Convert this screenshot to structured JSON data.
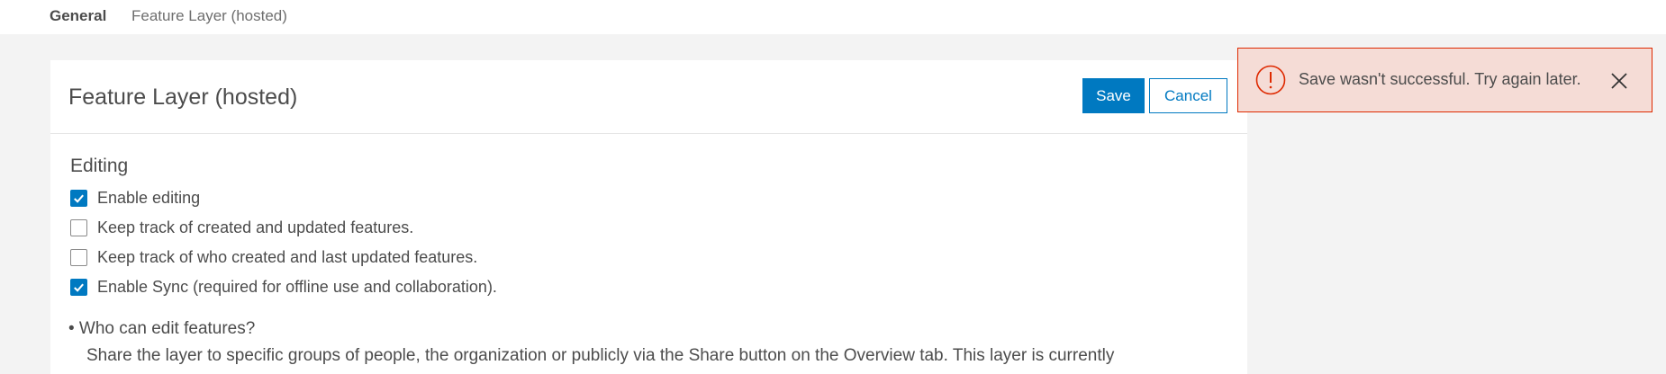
{
  "tabs": {
    "general": "General",
    "feature_layer": "Feature Layer (hosted)"
  },
  "card": {
    "title": "Feature Layer (hosted)",
    "save_label": "Save",
    "cancel_label": "Cancel"
  },
  "editing": {
    "section_title": "Editing",
    "options": [
      {
        "label": "Enable editing",
        "checked": true
      },
      {
        "label": "Keep track of created and updated features.",
        "checked": false
      },
      {
        "label": "Keep track of who created and last updated features.",
        "checked": false
      },
      {
        "label": "Enable Sync (required for offline use and collaboration).",
        "checked": true
      }
    ],
    "who_can_edit": "• Who can edit features?",
    "description": "Share the layer to specific groups of people, the organization or publicly via the Share button on the Overview tab. This layer is currently"
  },
  "toast": {
    "message": "Save wasn't successful. Try again later.",
    "status_color": "#de2900",
    "icon": "error-icon"
  },
  "colors": {
    "accent": "#0079c1",
    "error": "#de2900",
    "error_bg": "#f5dcd6"
  }
}
